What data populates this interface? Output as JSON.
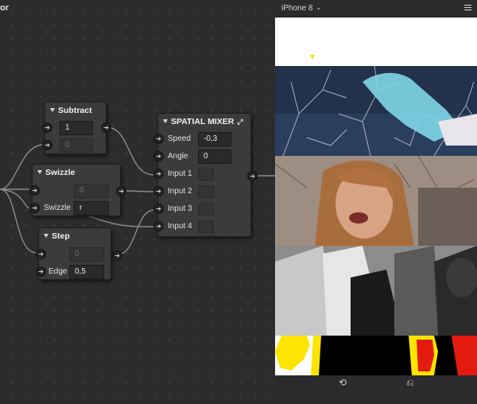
{
  "editor": {
    "title": "or"
  },
  "nodes": {
    "subtract": {
      "title": "Subtract",
      "value1": "1",
      "value2": "0"
    },
    "swizzle": {
      "title": "Swizzle",
      "value": "0",
      "param_label": "Swizzle",
      "param_value": "r"
    },
    "step": {
      "title": "Step",
      "value": "0",
      "param_label": "Edge",
      "param_value": "0,5"
    },
    "spatial_mixer": {
      "title": "SPATIAL MIXER",
      "expand_icon": "expand-icon",
      "speed_label": "Speed",
      "speed_value": "-0,3",
      "angle_label": "Angle",
      "angle_value": "0",
      "inputs": [
        "Input 1",
        "Input 2",
        "Input 3",
        "Input 4"
      ]
    }
  },
  "preview": {
    "device": "iPhone 8",
    "menu_icon": "hamburger-menu-icon",
    "footer": {
      "rotate_icon": "refresh-icon",
      "orientation_icon": "rotate-device-icon"
    }
  },
  "colors": {
    "canvas": "#2c2c2f",
    "node": "#3b3b3e",
    "wire": "#8a8a8c",
    "accent_yellow": "#ffe400",
    "accent_red": "#e31b0e"
  }
}
